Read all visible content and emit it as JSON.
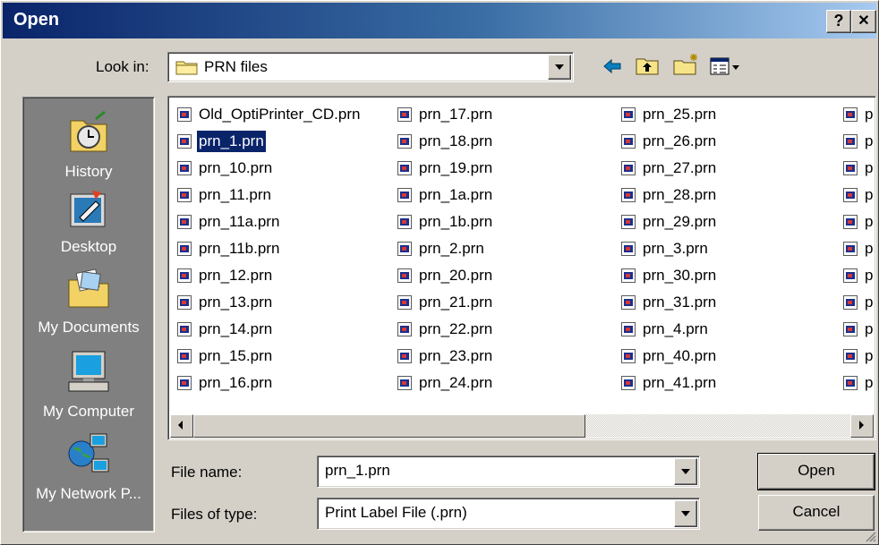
{
  "window": {
    "title": "Open",
    "help_glyph": "?",
    "close_glyph": "✕"
  },
  "lookin": {
    "label": "Look in:",
    "value": "PRN files"
  },
  "places": [
    {
      "label": "History",
      "icon": "history-icon"
    },
    {
      "label": "Desktop",
      "icon": "desktop-icon"
    },
    {
      "label": "My Documents",
      "icon": "my-documents-icon"
    },
    {
      "label": "My Computer",
      "icon": "my-computer-icon"
    },
    {
      "label": "My Network P...",
      "icon": "my-network-places-icon"
    }
  ],
  "files": {
    "col1": [
      "Old_OptiPrinter_CD.prn",
      "prn_1.prn",
      "prn_10.prn",
      "prn_11.prn",
      "prn_11a.prn",
      "prn_11b.prn",
      "prn_12.prn",
      "prn_13.prn",
      "prn_14.prn",
      "prn_15.prn",
      "prn_16.prn"
    ],
    "col2": [
      "prn_17.prn",
      "prn_18.prn",
      "prn_19.prn",
      "prn_1a.prn",
      "prn_1b.prn",
      "prn_2.prn",
      "prn_20.prn",
      "prn_21.prn",
      "prn_22.prn",
      "prn_23.prn",
      "prn_24.prn"
    ],
    "col3": [
      "prn_25.prn",
      "prn_26.prn",
      "prn_27.prn",
      "prn_28.prn",
      "prn_29.prn",
      "prn_3.prn",
      "prn_30.prn",
      "prn_31.prn",
      "prn_4.prn",
      "prn_40.prn",
      "prn_41.prn"
    ],
    "col4": [
      "p",
      "p",
      "p",
      "p",
      "p",
      "p",
      "p",
      "p",
      "p",
      "p",
      "p"
    ],
    "selected": "prn_1.prn"
  },
  "filename": {
    "label": "File name:",
    "value": "prn_1.prn"
  },
  "filetype": {
    "label": "Files of type:",
    "value": "Print Label File (.prn)"
  },
  "buttons": {
    "open": "Open",
    "cancel": "Cancel"
  },
  "colors": {
    "title_start": "#0a246a",
    "title_end": "#a6caf0",
    "face": "#d4d0c8",
    "places_bg": "#808080",
    "selection": "#0a246a"
  }
}
